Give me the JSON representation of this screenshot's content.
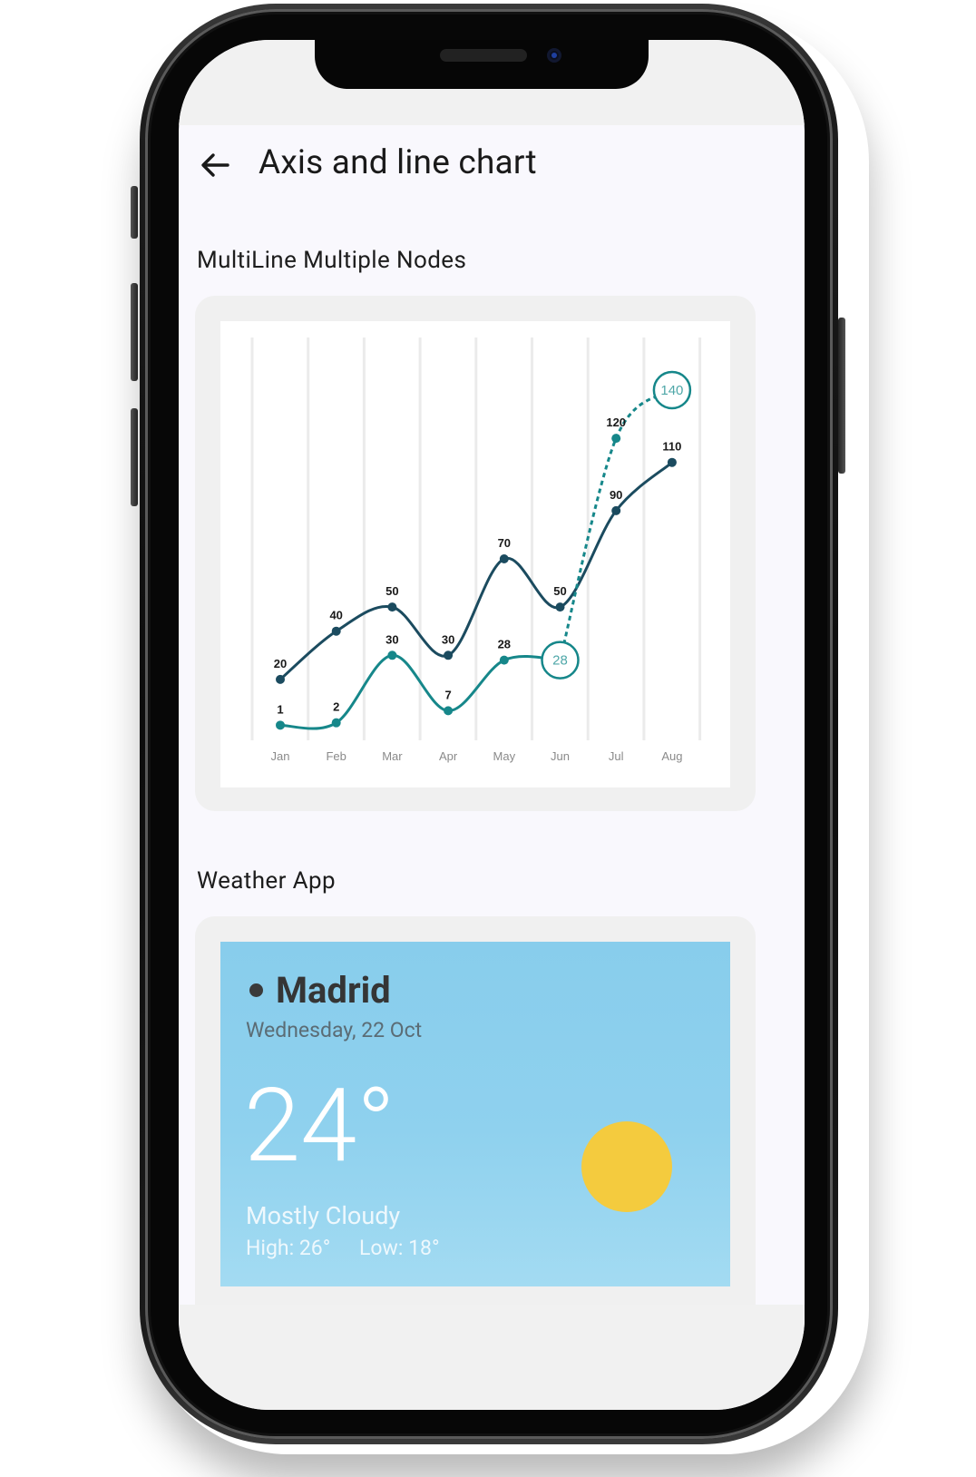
{
  "appbar": {
    "title": "Axis and line chart",
    "back_icon": "arrow-left-icon"
  },
  "sections": {
    "chart_title": "MultiLine Multiple Nodes",
    "weather_title": "Weather App"
  },
  "chart_data": {
    "type": "line",
    "categories": [
      "Jan",
      "Feb",
      "Mar",
      "Apr",
      "May",
      "Jun",
      "Jul",
      "Aug"
    ],
    "series": [
      {
        "values": [
          20,
          40,
          50,
          30,
          70,
          50,
          90,
          110
        ],
        "color": "#1b4b5f",
        "style": "solid",
        "highlighted": []
      },
      {
        "values": [
          1,
          2,
          30,
          7,
          28,
          28,
          120,
          140
        ],
        "color": "#16878a",
        "style": "solid-then-dashed",
        "dashed_from_index": 5,
        "highlighted": [
          5,
          7
        ]
      }
    ],
    "ylim": [
      0,
      140
    ],
    "grid": "vertical",
    "legend": "none",
    "title": "",
    "xlabel": "",
    "ylabel": ""
  },
  "weather": {
    "city": "Madrid",
    "date": "Wednesday, 22 Oct",
    "temperature": "24°",
    "condition": "Mostly Cloudy",
    "high": "High: 26°",
    "low": "Low: 18°",
    "icon": "sun-icon",
    "colors": {
      "sky": "#88cdec",
      "sun": "#f4cb3e"
    }
  }
}
